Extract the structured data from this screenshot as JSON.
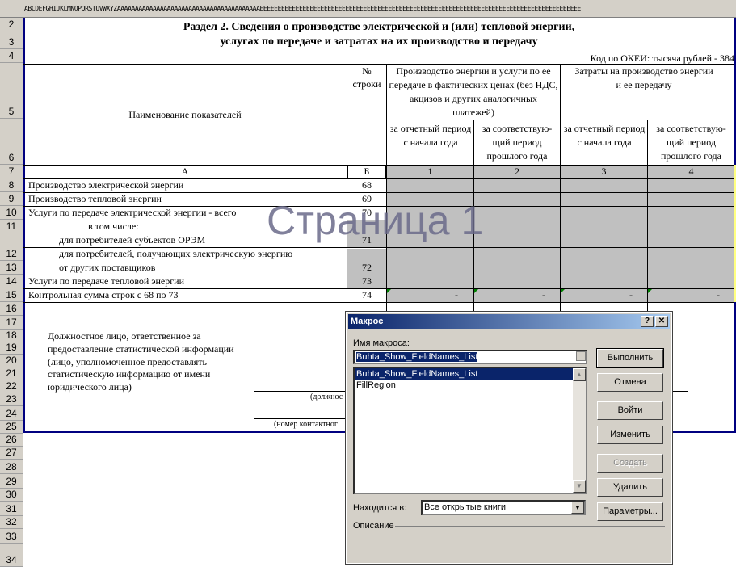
{
  "column_strip": "ABCDEFGHIJKLMNOPQRSTUVWXYZAAAAAAAAAAAAAAAAAAAAAAAAAAAAAAAAAAAAAAAAEEEEEEEEEEEEEEEEEEEEEEEEEEEEEEEEEEEEEEEEEEEEEEEEEEEEEEEEEEEEEEEEEEEEEEEEEEEEEEEEEEEEEEEEEE",
  "rows": [
    "2",
    "3",
    "4",
    "5",
    "6",
    "7",
    "8",
    "9",
    "10",
    "11",
    "12",
    "13",
    "14",
    "15",
    "16",
    "17",
    "18",
    "19",
    "20",
    "21",
    "22",
    "23",
    "24",
    "25",
    "26",
    "27",
    "28",
    "29",
    "30",
    "31",
    "32",
    "33",
    "34"
  ],
  "sheet": {
    "title_line1": "Раздел 2. Сведения о производстве электрической и (или) тепловой энергии,",
    "title_line2": "услугах по передаче и затратах на их производство и передачу",
    "okei": "Код по ОКЕИ: тысяча рублей - 384",
    "hdr_name": "Наименование показателей",
    "hdr_num": "№ строки",
    "hdr_prod": "Производство энергии и услуги по ее передаче в фактических ценах (без НДС, акцизов и других аналогичных платежей)",
    "hdr_cost": "Затраты на производство энергии и ее передачу",
    "sub_cur1": "за отчетный период с начала года",
    "sub_prev1": "за соответствую-щий период прошлого года",
    "sub_cur2": "за отчетный период с начала года",
    "sub_prev2": "за соответствую-щий период прошлого года",
    "col_a": "А",
    "col_b": "Б",
    "col_1": "1",
    "col_2": "2",
    "col_3": "3",
    "col_4": "4",
    "r8": "Производство электрической энергии",
    "n8": "68",
    "r9": "Производство тепловой энергии",
    "n9": "69",
    "r10": "Услуги по передаче электрической энергии - всего",
    "n10": "70",
    "r11": "в том числе:",
    "r12": "для потребителей субъектов ОРЭМ",
    "n12": "71",
    "r13a": "для потребителей, получающих электрическую энергию",
    "r13b": "от других поставщиков",
    "n13": "72",
    "r14": "Услуги по передаче тепловой энергии",
    "n14": "73",
    "r15": "Контрольная сумма строк с 68 по 73",
    "n15": "74",
    "dash": "-",
    "official1": "Должностное лицо, ответственное за",
    "official2": "предоставление статистической информации",
    "official3": "(лицо, уполномоченное предоставлять",
    "official4": "статистическую информацию от имени",
    "official5": "юридического лица)",
    "sig1": "(должнос",
    "sig2": "(номер контактног",
    "watermark": "Страница 1"
  },
  "dialog": {
    "title": "Макрос",
    "help": "?",
    "close": "✕",
    "name_label": "Имя макроса:",
    "name_value": "Buhta_Show_FieldNames_List",
    "macros": [
      "Buhta_Show_FieldNames_List",
      "FillRegion"
    ],
    "run": "Выполнить",
    "cancel": "Отмена",
    "step_into": "Войти",
    "edit": "Изменить",
    "create": "Создать",
    "delete": "Удалить",
    "options": "Параметры...",
    "location_label": "Находится в:",
    "location_value": "Все открытые книги",
    "description_label": "Описание"
  }
}
